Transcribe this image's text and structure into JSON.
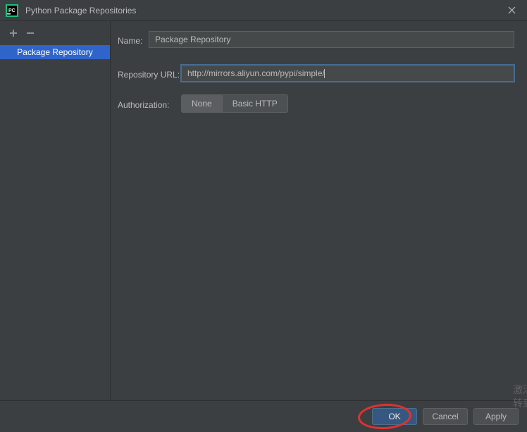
{
  "titlebar": {
    "title": "Python Package Repositories"
  },
  "sidebar": {
    "add_icon": "+",
    "remove_icon": "−",
    "items": [
      {
        "label": "Package Repository"
      }
    ]
  },
  "form": {
    "name_label": "Name:",
    "name_value": "Package Repository",
    "url_label": "Repository URL:",
    "url_value": "http://mirrors.aliyun.com/pypi/simple/",
    "auth_label": "Authorization:",
    "auth_options": {
      "none": "None",
      "basic": "Basic HTTP"
    }
  },
  "footer": {
    "ok": "OK",
    "cancel": "Cancel",
    "apply": "Apply"
  },
  "watermark": {
    "line1": "激活",
    "line2": "转到"
  }
}
